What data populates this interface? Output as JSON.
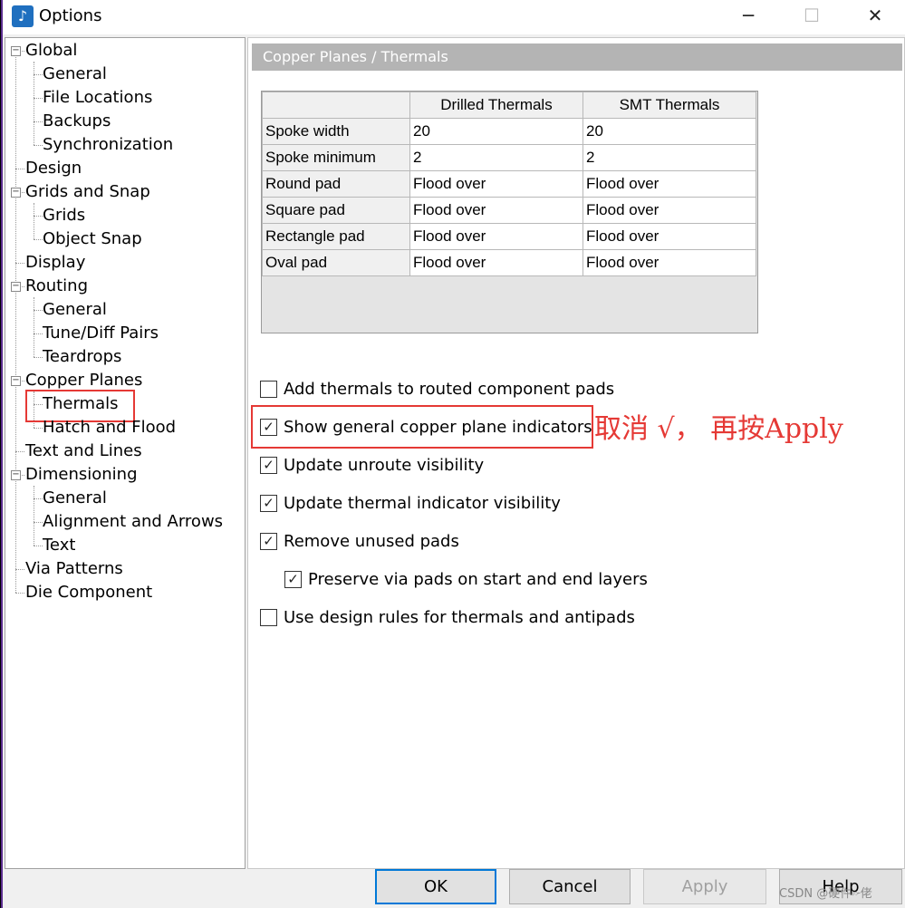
{
  "window": {
    "title": "Options",
    "app_icon": "options-app-icon",
    "minimize": "─",
    "maximize": "☐",
    "close": "✕"
  },
  "tree": {
    "items": [
      {
        "label": "Global",
        "level": 0,
        "expandable": true
      },
      {
        "label": "General",
        "level": 1
      },
      {
        "label": "File Locations",
        "level": 1
      },
      {
        "label": "Backups",
        "level": 1
      },
      {
        "label": "Synchronization",
        "level": 1
      },
      {
        "label": "Design",
        "level": 0
      },
      {
        "label": "Grids and Snap",
        "level": 0,
        "expandable": true
      },
      {
        "label": "Grids",
        "level": 1
      },
      {
        "label": "Object Snap",
        "level": 1
      },
      {
        "label": "Display",
        "level": 0
      },
      {
        "label": "Routing",
        "level": 0,
        "expandable": true
      },
      {
        "label": "General",
        "level": 1
      },
      {
        "label": "Tune/Diff Pairs",
        "level": 1
      },
      {
        "label": "Teardrops",
        "level": 1
      },
      {
        "label": "Copper Planes",
        "level": 0,
        "expandable": true
      },
      {
        "label": "Thermals",
        "level": 1,
        "selected": true
      },
      {
        "label": "Hatch and Flood",
        "level": 1
      },
      {
        "label": "Text and Lines",
        "level": 0
      },
      {
        "label": "Dimensioning",
        "level": 0,
        "expandable": true
      },
      {
        "label": "General",
        "level": 1
      },
      {
        "label": "Alignment and Arrows",
        "level": 1
      },
      {
        "label": "Text",
        "level": 1
      },
      {
        "label": "Via Patterns",
        "level": 0
      },
      {
        "label": "Die Component",
        "level": 0
      }
    ]
  },
  "panel": {
    "header": "Copper Planes / Thermals",
    "table": {
      "columns": [
        "",
        "Drilled Thermals",
        "SMT Thermals"
      ],
      "rows": [
        [
          "Spoke width",
          "20",
          "20"
        ],
        [
          "Spoke minimum",
          "2",
          "2"
        ],
        [
          "Round pad",
          "Flood over",
          "Flood over"
        ],
        [
          "Square pad",
          "Flood over",
          "Flood over"
        ],
        [
          "Rectangle pad",
          "Flood over",
          "Flood over"
        ],
        [
          "Oval pad",
          "Flood over",
          "Flood over"
        ]
      ]
    },
    "options": [
      {
        "label": "Add thermals to routed component pads",
        "checked": false,
        "indent": 0
      },
      {
        "label": "Show general copper plane indicators",
        "checked": true,
        "indent": 0
      },
      {
        "label": "Update unroute visibility",
        "checked": true,
        "indent": 0
      },
      {
        "label": "Update thermal indicator visibility",
        "checked": true,
        "indent": 0
      },
      {
        "label": "Remove unused pads",
        "checked": true,
        "indent": 0
      },
      {
        "label": "Preserve via pads on start and end layers",
        "checked": true,
        "indent": 1
      },
      {
        "label": "Use design rules for thermals and antipads",
        "checked": false,
        "indent": 0
      }
    ],
    "annotation": "取消 √， 再按Apply"
  },
  "buttons": {
    "ok": "OK",
    "cancel": "Cancel",
    "apply": "Apply",
    "help": "Help"
  },
  "watermark": "CSDN @硬件🖙佬",
  "colors": {
    "highlight_red": "#e53935",
    "header_gray": "#b4b4b4",
    "default_button_border": "#0078d7"
  }
}
